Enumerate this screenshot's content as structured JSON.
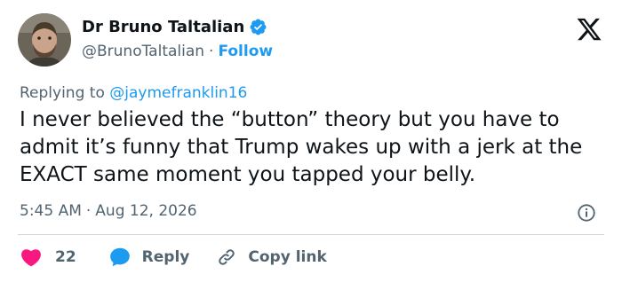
{
  "author": {
    "display_name": "Dr Bruno Taltalian",
    "handle": "@BrunoTaltalian",
    "separator": "·",
    "follow_label": "Follow"
  },
  "reply_context": {
    "prefix": "Replying to ",
    "handle": "@jaymefranklin16"
  },
  "tweet": {
    "text": "I never believed the “button” theory but you have to admit it’s funny that Trump wakes up with a jerk at the EXACT same moment you tapped your belly."
  },
  "meta": {
    "time": "5:45 AM",
    "separator": "·",
    "date": "Aug 12, 2026"
  },
  "actions": {
    "like_count": "22",
    "reply_label": "Reply",
    "copy_link_label": "Copy link"
  },
  "colors": {
    "accent": "#1d9bf0",
    "like": "#f91880",
    "text": "#0f1419",
    "secondary": "#536471",
    "divider": "#cfd9de"
  },
  "icons": [
    "verified-badge-icon",
    "x-logo-icon",
    "info-icon",
    "heart-icon",
    "reply-bubble-icon",
    "link-icon"
  ]
}
